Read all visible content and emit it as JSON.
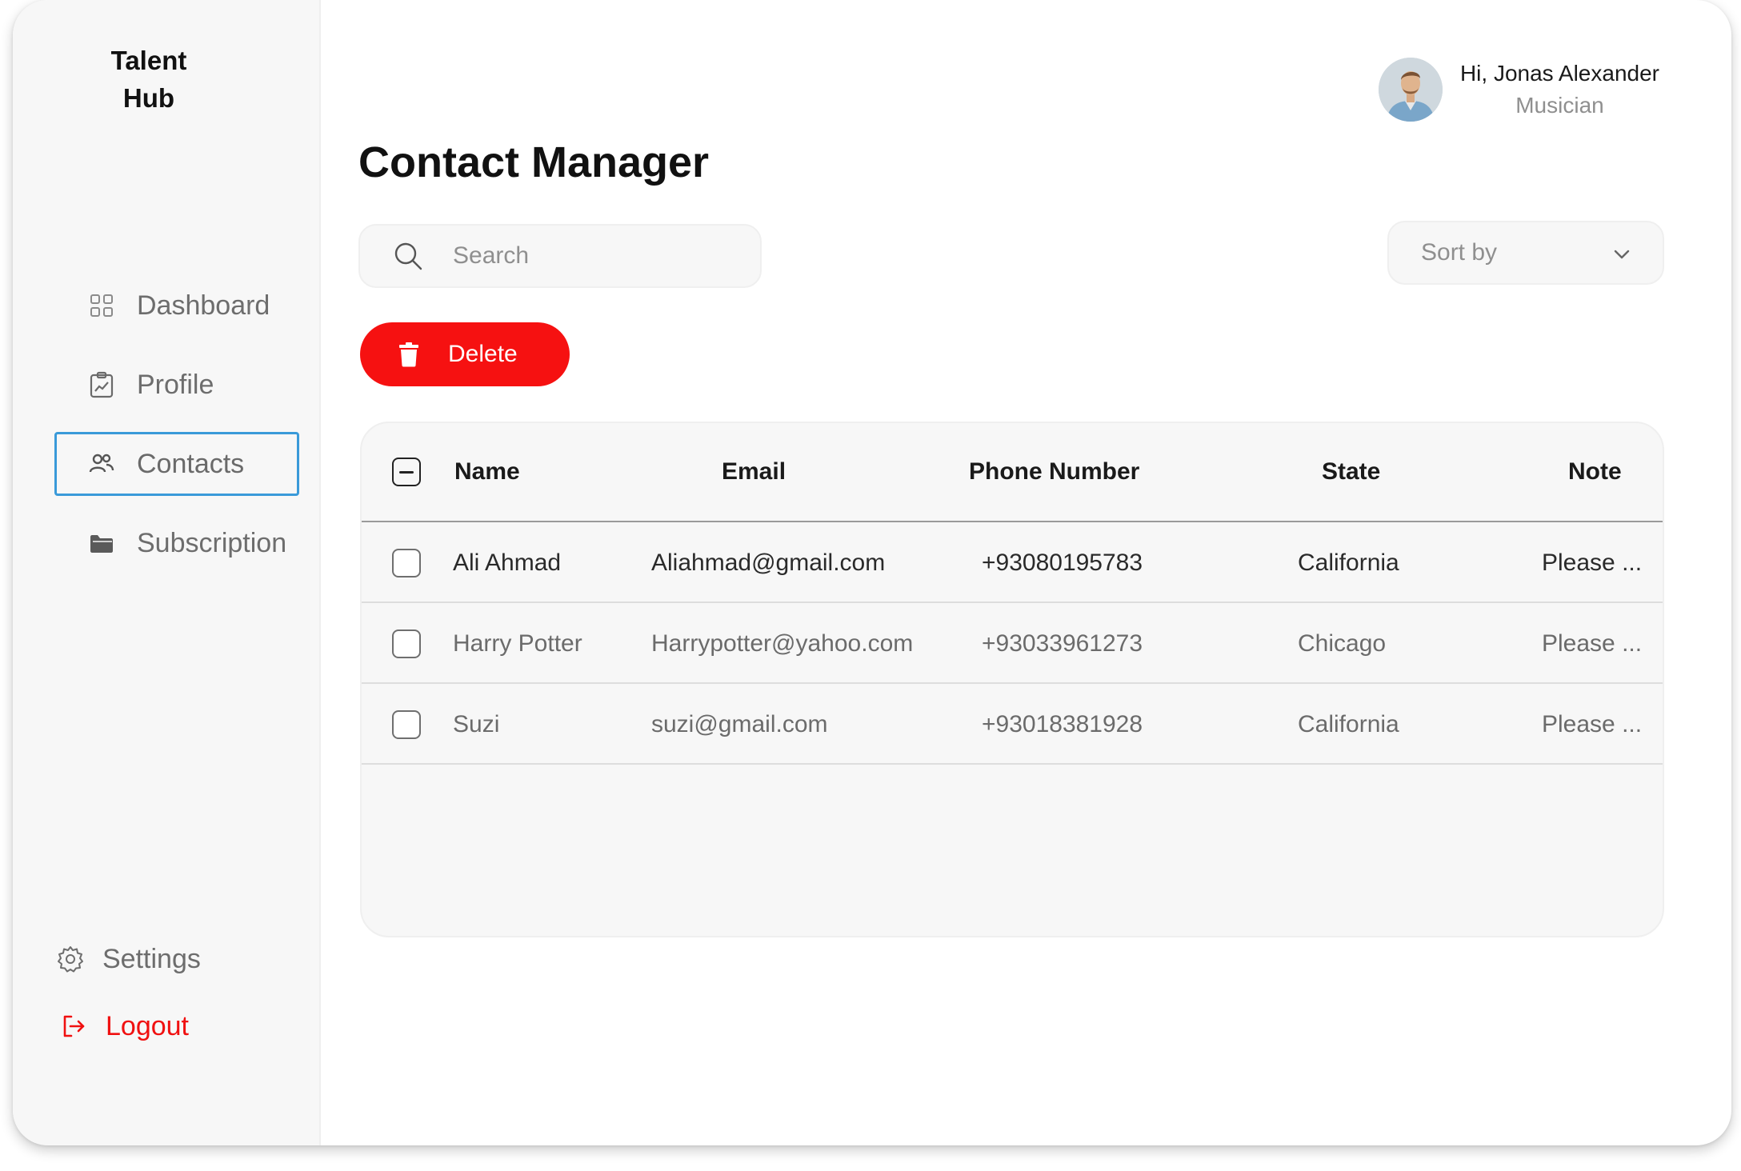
{
  "app": {
    "logo_line1": "Talent",
    "logo_line2": "Hub"
  },
  "sidebar": {
    "items": [
      {
        "label": "Dashboard",
        "icon": "grid-icon"
      },
      {
        "label": "Profile",
        "icon": "profile-chart-icon"
      },
      {
        "label": "Contacts",
        "icon": "users-icon",
        "active": true
      },
      {
        "label": "Subscription",
        "icon": "folder-icon"
      }
    ],
    "settings_label": "Settings",
    "logout_label": "Logout"
  },
  "user": {
    "greeting": "Hi, Jonas Alexander",
    "role": "Musician"
  },
  "page": {
    "title": "Contact Manager"
  },
  "search": {
    "placeholder": "Search",
    "value": ""
  },
  "sort": {
    "label": "Sort by"
  },
  "actions": {
    "delete_label": "Delete"
  },
  "table": {
    "headers": {
      "name": "Name",
      "email": "Email",
      "phone": "Phone Number",
      "state": "State",
      "note": "Note"
    },
    "rows": [
      {
        "name": "Ali Ahmad",
        "email": "Aliahmad@gmail.com",
        "phone": "+93080195783",
        "state": "California",
        "note": "Please ..."
      },
      {
        "name": "Harry Potter",
        "email": "Harrypotter@yahoo.com",
        "phone": "+93033961273",
        "state": "Chicago",
        "note": "Please ..."
      },
      {
        "name": "Suzi",
        "email": "suzi@gmail.com",
        "phone": "+93018381928",
        "state": "California",
        "note": "Please ..."
      }
    ]
  },
  "colors": {
    "accent_red": "#f61111",
    "active_border": "#3a9ad9",
    "sidebar_bg": "#f7f7f7"
  }
}
